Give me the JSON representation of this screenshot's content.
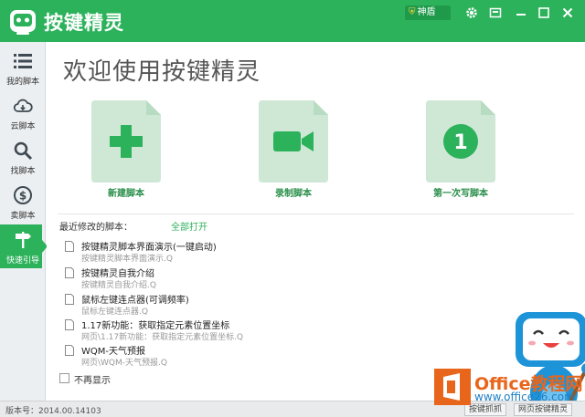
{
  "app": {
    "title": "按键精灵",
    "badge": "神盾"
  },
  "colors": {
    "brand": "#2db25c",
    "brand_dark": "#1f9a4b",
    "card_bg": "#cfe8d6",
    "watermark_orange": "#e8661c",
    "watermark_blue": "#1f7fc4"
  },
  "sidebar": {
    "items": [
      {
        "label": "我的脚本",
        "icon": "list-icon"
      },
      {
        "label": "云脚本",
        "icon": "cloud-icon"
      },
      {
        "label": "找脚本",
        "icon": "search-icon"
      },
      {
        "label": "卖脚本",
        "icon": "dollar-icon"
      },
      {
        "label": "快速引导",
        "icon": "signpost-icon"
      }
    ],
    "active_index": 4
  },
  "main": {
    "welcome": "欢迎使用按键精灵",
    "cards": [
      {
        "label": "新建脚本",
        "icon": "plus-icon"
      },
      {
        "label": "录制脚本",
        "icon": "video-camera-icon"
      },
      {
        "label": "第一次写脚本",
        "icon": "number-one-icon",
        "glyph": "1"
      }
    ],
    "recent_title": "最近修改的脚本：",
    "open_all": "全部打开",
    "recent_files": [
      {
        "name": "按键精灵脚本界面演示(一键启动)",
        "path": "按键精灵脚本界面演示.Q"
      },
      {
        "name": "按键精灵自我介绍",
        "path": "按键精灵自我介绍.Q"
      },
      {
        "name": "鼠标左键连点器(可调频率)",
        "path": "鼠标左键连点器.Q"
      },
      {
        "name": "1.17新功能：获取指定元素位置坐标",
        "path": "网页\\1.17新功能：获取指定元素位置坐标.Q"
      },
      {
        "name": "WQM-天气预报",
        "path": "网页\\WQM-天气预报.Q"
      }
    ],
    "dont_show_again": "不再显示"
  },
  "status": {
    "version": "版本号：2014.00.14103",
    "btn_script": "按键抓抓",
    "btn_assistant": "网页按键精灵"
  },
  "watermark": {
    "line1": "Office教程网",
    "line2": "www.office26.com"
  }
}
